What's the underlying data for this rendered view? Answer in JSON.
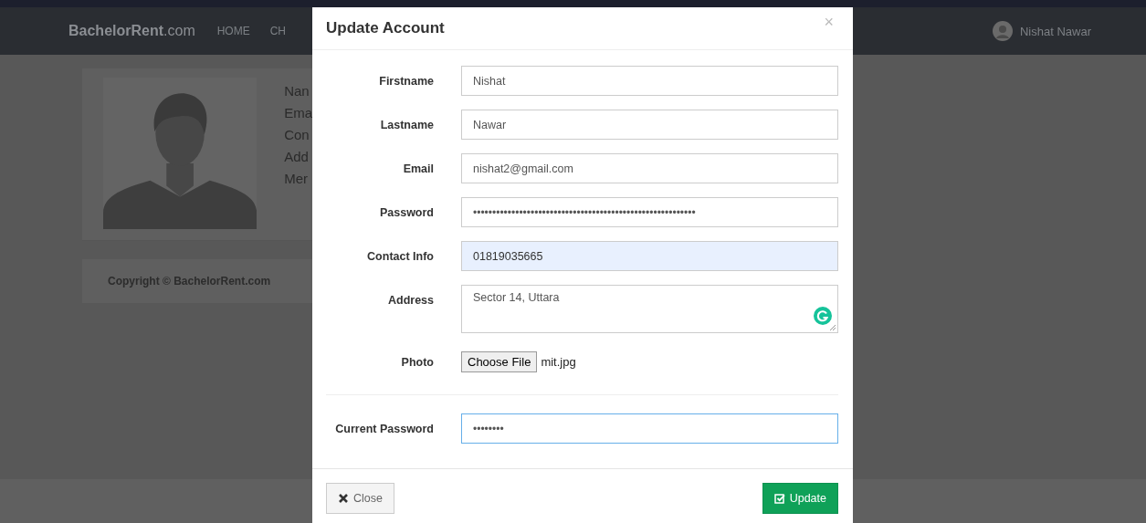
{
  "navbar": {
    "brand": "**BachelorRent**.com",
    "links": [
      "HOME",
      "CH"
    ],
    "user": "Nishat Nawar"
  },
  "profile": {
    "lines": [
      "Nan",
      "Ema",
      "Con",
      "Add",
      "Mer"
    ],
    "copyright": "Copyright © BachelorRent.com"
  },
  "modal": {
    "title": "Update Account",
    "close_icon": "×",
    "fields": [
      {
        "kind": "text",
        "label": "Firstname",
        "value": "Nishat",
        "autofilled": false,
        "focused": false
      },
      {
        "kind": "text",
        "label": "Lastname",
        "value": "Nawar",
        "autofilled": false,
        "focused": false
      },
      {
        "kind": "text",
        "label": "Email",
        "value": "nishat2@gmail.com",
        "autofilled": false,
        "focused": false
      },
      {
        "kind": "password",
        "label": "Password",
        "value": "••••••••••••••••••••••••••••••••••••••••••••••••••••••••••",
        "autofilled": false,
        "focused": false
      },
      {
        "kind": "text",
        "label": "Contact Info",
        "value": "01819035665",
        "autofilled": true,
        "focused": false
      },
      {
        "kind": "textarea",
        "label": "Address",
        "value": "Sector 14, Uttara",
        "autofilled": false,
        "focused": false
      },
      {
        "kind": "file",
        "label": "Photo",
        "button": "Choose File",
        "value": "mit.jpg"
      },
      {
        "kind": "divider"
      },
      {
        "kind": "password",
        "label": "Current Password",
        "value": "••••••••",
        "autofilled": false,
        "focused": true
      }
    ],
    "buttons": [
      {
        "kind": "close",
        "label": "Close"
      },
      {
        "kind": "update",
        "label": "Update"
      }
    ]
  }
}
